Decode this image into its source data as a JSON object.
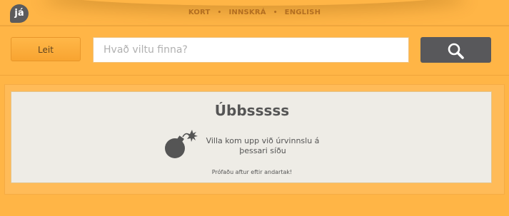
{
  "header": {
    "logo_text": "já",
    "nav": [
      {
        "label": "KORT"
      },
      {
        "label": "INNSKRÁ"
      },
      {
        "label": "ENGLISH"
      }
    ],
    "separator": "•"
  },
  "search": {
    "leit_label": "Leit",
    "placeholder": "Hvað viltu finna?",
    "value": "",
    "button_icon": "search-icon"
  },
  "error": {
    "title": "Úbbsssss",
    "message": "Villa kom upp við úrvinnslu á þessari síðu",
    "retry": "Prófaðu aftur eftir andartak!",
    "icon": "bomb-icon"
  },
  "colors": {
    "background": "#ffb546",
    "panel": "#eeece6",
    "dark_button": "#58585b",
    "text": "#555555"
  }
}
